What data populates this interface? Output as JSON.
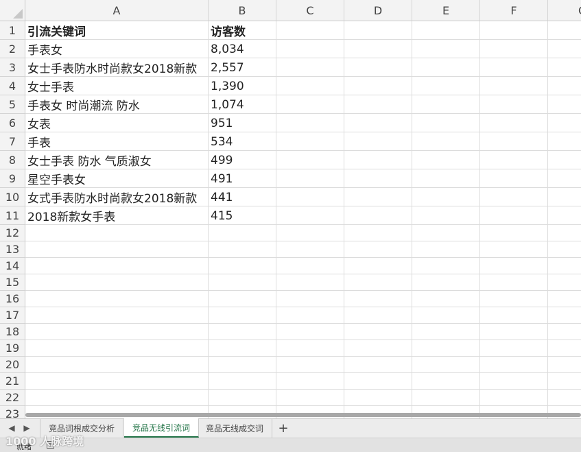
{
  "columns": [
    "A",
    "B",
    "C",
    "D",
    "E",
    "F",
    "G"
  ],
  "rows": [
    "1",
    "2",
    "3",
    "4",
    "5",
    "6",
    "7",
    "8",
    "9",
    "10",
    "11",
    "12",
    "13",
    "14",
    "15",
    "16",
    "17",
    "18",
    "19",
    "20",
    "21",
    "22",
    "23"
  ],
  "header_row": {
    "a": "引流关键词",
    "b": "访客数"
  },
  "data_rows": [
    {
      "a": "手表女",
      "b": "8,034"
    },
    {
      "a": "女士手表防水时尚款女2018新款",
      "b": "2,557"
    },
    {
      "a": "女士手表",
      "b": "1,390"
    },
    {
      "a": "手表女 时尚潮流 防水",
      "b": "1,074"
    },
    {
      "a": "女表",
      "b": "951"
    },
    {
      "a": "手表",
      "b": "534"
    },
    {
      "a": "女士手表 防水 气质淑女",
      "b": "499"
    },
    {
      "a": "星空手表女",
      "b": "491"
    },
    {
      "a": "女式手表防水时尚款女2018新款",
      "b": "441"
    },
    {
      "a": "2018新款女手表",
      "b": "415"
    }
  ],
  "sheet_tabs": [
    {
      "label": "竞品词根成交分析",
      "active": false
    },
    {
      "label": "竞品无线引流词",
      "active": true
    },
    {
      "label": "竞品无线成交词",
      "active": false
    }
  ],
  "tab_nav": {
    "prev": "◀",
    "next": "▶",
    "add": "+"
  },
  "status": {
    "ready": "就绪"
  },
  "watermark": "1000 人脉跨境",
  "colors": {
    "active_tab": "#217346",
    "header_bg": "#f3f3f3",
    "grid": "#dcdcdc"
  }
}
